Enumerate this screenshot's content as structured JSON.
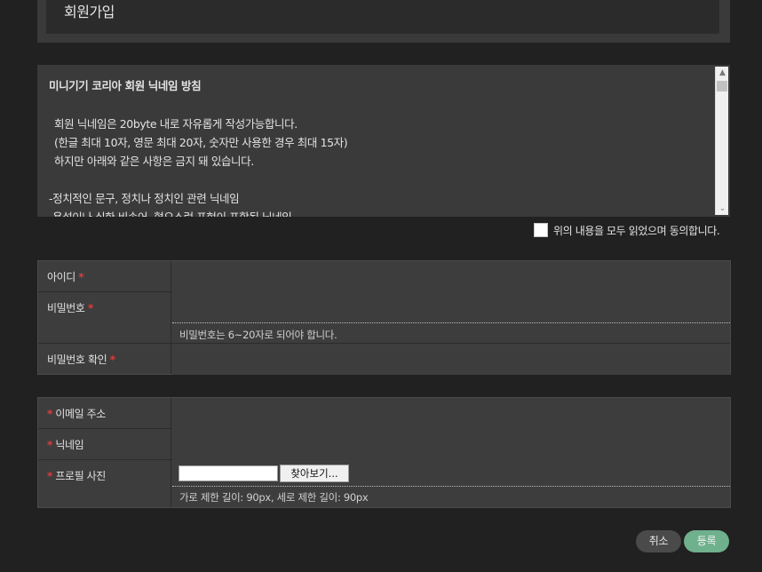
{
  "header": {
    "title": "회원가입"
  },
  "terms": {
    "title": "미니기기 코리아 회원 닉네임 방침",
    "lines": [
      "회원 닉네임은 20byte 내로 자유롭게 작성가능합니다.",
      "(한글 최대 10자, 영문 최대 20자, 숫자만 사용한 경우 최대 15자)",
      "하지만 아래와 같은 사항은 금지 돼 있습니다.",
      "-정치적인 문구, 정치나 정치인 관련 닉네임",
      "-욕설이나 심한 비속어, 혐오스런 표현이 포함된 닉네임"
    ]
  },
  "agree": {
    "label": "위의 내용을 모두 읽었으며 동의합니다."
  },
  "account_form": {
    "id_label": "아이디",
    "password_label": "비밀번호",
    "password_hint": "비밀번호는 6~20자로 되어야 합니다.",
    "password_confirm_label": "비밀번호 확인"
  },
  "profile_form": {
    "email_label": "이메일 주소",
    "nickname_label": "닉네임",
    "photo_label": "프로필 사진",
    "file_button": "찾아보기...",
    "photo_hint": "가로 제한 길이: 90px, 세로 제한 길이: 90px"
  },
  "required_mark": "*",
  "buttons": {
    "cancel": "취소",
    "submit": "등록"
  },
  "colors": {
    "background": "#212121",
    "panel": "#3d3d3d",
    "required": "#e03a3a",
    "submit": "#6fb08d"
  }
}
